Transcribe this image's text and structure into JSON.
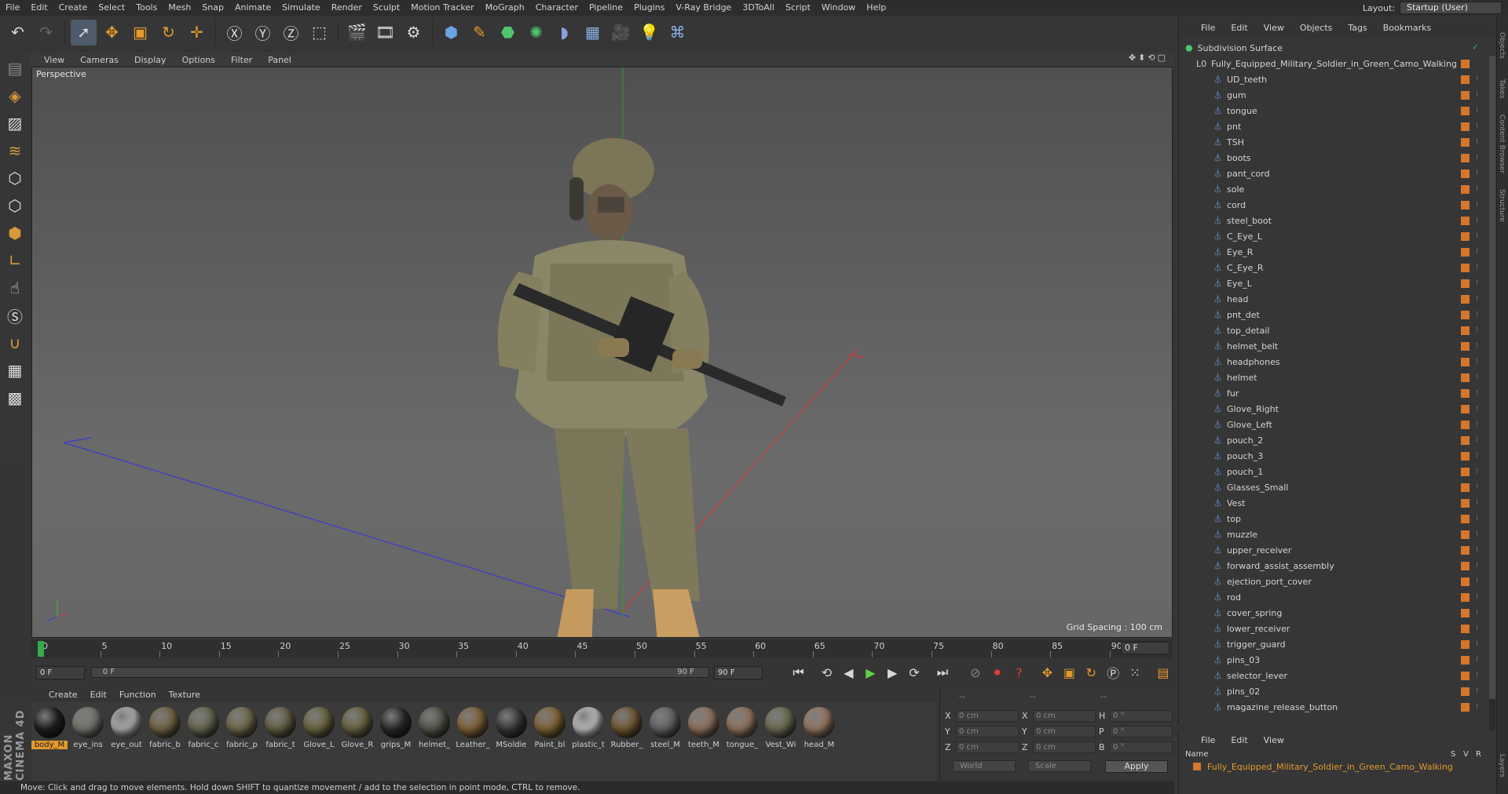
{
  "menubar": {
    "items": [
      "File",
      "Edit",
      "Create",
      "Select",
      "Tools",
      "Mesh",
      "Snap",
      "Animate",
      "Simulate",
      "Render",
      "Sculpt",
      "Motion Tracker",
      "MoGraph",
      "Character",
      "Pipeline",
      "Plugins",
      "V-Ray Bridge",
      "3DToAll",
      "Script",
      "Window",
      "Help"
    ],
    "layout_label": "Layout:",
    "layout_value": "Startup (User)"
  },
  "viewport": {
    "menu": [
      "View",
      "Cameras",
      "Display",
      "Options",
      "Filter",
      "Panel"
    ],
    "label": "Perspective",
    "grid_spacing": "Grid Spacing : 100 cm"
  },
  "timeline": {
    "ticks": [
      "0",
      "5",
      "10",
      "15",
      "20",
      "25",
      "30",
      "35",
      "40",
      "45",
      "50",
      "55",
      "60",
      "65",
      "70",
      "75",
      "80",
      "85",
      "90"
    ],
    "current_frame": "0 F",
    "start_field": "0 F",
    "slider_start": "0 F",
    "slider_end": "90 F",
    "end_field": "90 F"
  },
  "materials": {
    "menu": [
      "Create",
      "Edit",
      "Function",
      "Texture"
    ],
    "items": [
      {
        "label": "body_M",
        "color": "#222222"
      },
      {
        "label": "eye_ins",
        "color": "#7a7d74"
      },
      {
        "label": "eye_out",
        "color": "#b8b8b8"
      },
      {
        "label": "fabric_b",
        "color": "#7a6a48"
      },
      {
        "label": "fabric_c",
        "color": "#6e6e56"
      },
      {
        "label": "fabric_p",
        "color": "#76704e"
      },
      {
        "label": "fabric_t",
        "color": "#6a6548"
      },
      {
        "label": "Glove_L",
        "color": "#726c46"
      },
      {
        "label": "Glove_R",
        "color": "#6f6a44"
      },
      {
        "label": "grips_M",
        "color": "#2e2e2e"
      },
      {
        "label": "helmet_",
        "color": "#5a5a50"
      },
      {
        "label": "Leather_",
        "color": "#8a6a3c"
      },
      {
        "label": "MSoldie",
        "color": "#3e3e3e"
      },
      {
        "label": "Paint_bl",
        "color": "#8a6a3a"
      },
      {
        "label": "plastic_t",
        "color": "#c8c8c8"
      },
      {
        "label": "Rubber_",
        "color": "#7a6038"
      },
      {
        "label": "steel_M",
        "color": "#6a6a6a"
      },
      {
        "label": "teeth_M",
        "color": "#9a7a64"
      },
      {
        "label": "tongue_",
        "color": "#9a7c66"
      },
      {
        "label": "Vest_Wi",
        "color": "#74745a"
      },
      {
        "label": "head_M",
        "color": "#a0806a"
      }
    ],
    "brand": "MAXON CINEMA 4D"
  },
  "coords": {
    "rows": [
      {
        "a": "X",
        "av": "0 cm",
        "b": "X",
        "bv": "0 cm",
        "c": "H",
        "cv": "0 °"
      },
      {
        "a": "Y",
        "av": "0 cm",
        "b": "Y",
        "bv": "0 cm",
        "c": "P",
        "cv": "0 °"
      },
      {
        "a": "Z",
        "av": "0 cm",
        "b": "Z",
        "bv": "0 cm",
        "c": "B",
        "cv": "0 °"
      }
    ],
    "col_headers": [
      "--",
      "--",
      "--"
    ],
    "world": "World",
    "scale": "Scale",
    "apply": "Apply"
  },
  "status": "Move: Click and drag to move elements. Hold down SHIFT to quantize movement / add to the selection in point mode, CTRL to remove.",
  "object_manager": {
    "menu": [
      "File",
      "Edit",
      "View",
      "Objects",
      "Tags",
      "Bookmarks"
    ],
    "root": "Subdivision Surface",
    "group": "Fully_Equipped_Military_Soldier_in_Green_Camo_Walking",
    "children": [
      "UD_teeth",
      "gum",
      "tongue",
      "pnt",
      "TSH",
      "boots",
      "pant_cord",
      "sole",
      "cord",
      "steel_boot",
      "C_Eye_L",
      "Eye_R",
      "C_Eye_R",
      "Eye_L",
      "head",
      "pnt_det",
      "top_detail",
      "helmet_belt",
      "headphones",
      "helmet",
      "fur",
      "Glove_Right",
      "Glove_Left",
      "pouch_2",
      "pouch_3",
      "pouch_1",
      "Glasses_Small",
      "Vest",
      "top",
      "muzzle",
      "upper_receiver",
      "forward_assist_assembly",
      "ejection_port_cover",
      "rod",
      "cover_spring",
      "lower_receiver",
      "trigger_guard",
      "pins_03",
      "selector_lever",
      "pins_02",
      "magazine_release_button"
    ]
  },
  "attributes": {
    "menu": [
      "File",
      "Edit",
      "View"
    ],
    "header_name": "Name",
    "header_flags": [
      "S",
      "V",
      "R"
    ],
    "item": "Fully_Equipped_Military_Soldier_in_Green_Camo_Walking"
  },
  "side_tabs": [
    "Objects",
    "Takes",
    "Content Browser",
    "Structure",
    "Layers"
  ]
}
